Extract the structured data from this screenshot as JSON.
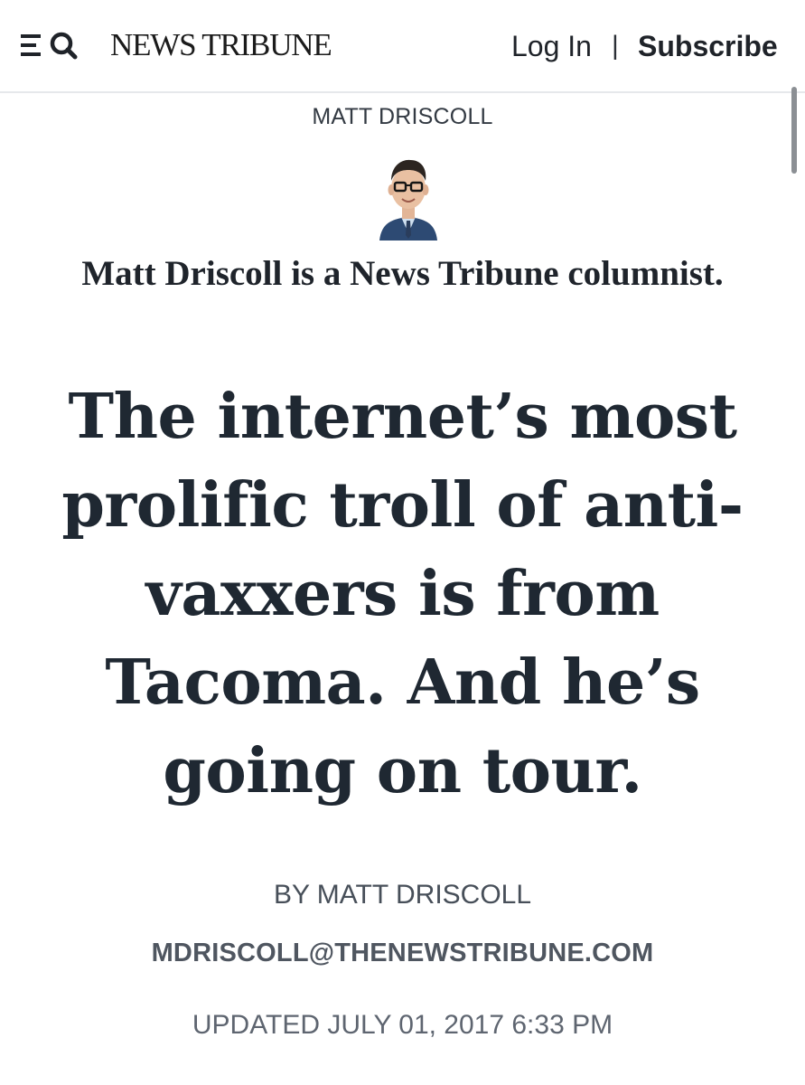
{
  "header": {
    "masthead": "NEWS TRIBUNE",
    "login_label": "Log In",
    "separator": "|",
    "subscribe_label": "Subscribe",
    "menu_icon": "hamburger-menu-icon",
    "search_icon": "search-icon"
  },
  "author": {
    "name": "MATT DRISCOLL",
    "bio": "Matt Driscoll is a News Tribune columnist."
  },
  "article": {
    "headline": "The internet’s most prolific troll of anti-vaxxers is from Tacoma. And he’s going on tour.",
    "byline": "BY MATT DRISCOLL",
    "email": "MDRISCOLL@THENEWSTRIBUNE.COM",
    "updated": "UPDATED JULY 01, 2017 6:33 PM"
  },
  "colors": {
    "text_dark": "#1f2832",
    "meta_gray": "#5e6570",
    "divider": "#e6e8eb"
  }
}
